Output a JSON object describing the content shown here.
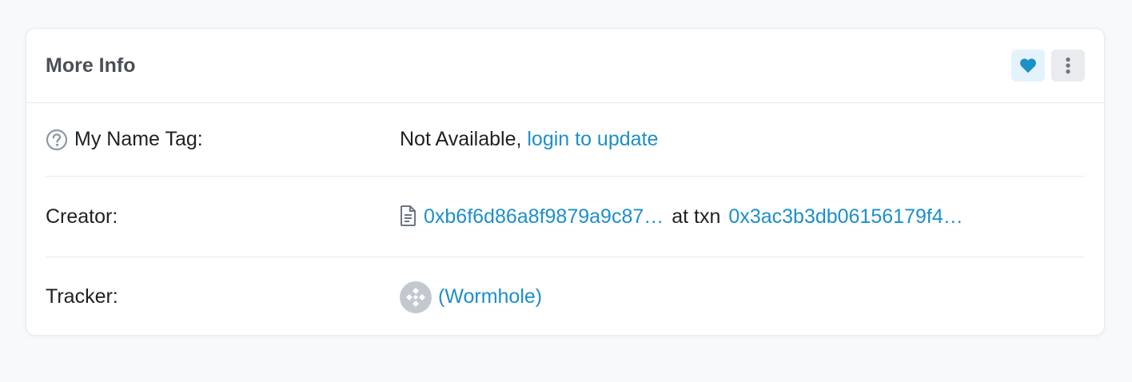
{
  "card": {
    "title": "More Info"
  },
  "header_actions": {
    "favorite_icon": "heart-icon",
    "more_icon": "vertical-dots-icon"
  },
  "rows": {
    "name_tag": {
      "label": "My Name Tag:",
      "value": "Not Available,",
      "link": "login to update",
      "icon": "question-circle-icon"
    },
    "creator": {
      "label": "Creator:",
      "address": "0xb6f6d86a8f9879a9c87…",
      "at_txn": "at txn",
      "txn_hash": "0x3ac3b3db06156179f4…",
      "icon": "file-icon"
    },
    "tracker": {
      "label": "Tracker:",
      "token": "(Wormhole)",
      "icon": "token-logo-icon"
    }
  },
  "colors": {
    "link": "#1d8fc9",
    "favorite_bg": "#e4f2fb",
    "more_bg": "#e9ebee",
    "divider": "#e7eaf3"
  }
}
